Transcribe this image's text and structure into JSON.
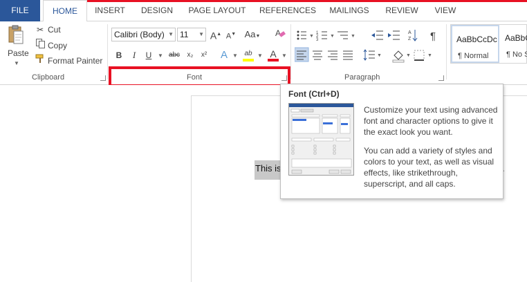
{
  "tabs": [
    "FILE",
    "HOME",
    "INSERT",
    "DESIGN",
    "PAGE LAYOUT",
    "REFERENCES",
    "MAILINGS",
    "REVIEW",
    "VIEW"
  ],
  "clipboard": {
    "paste": "Paste",
    "cut": "Cut",
    "copy": "Copy",
    "format_painter": "Format Painter",
    "group_label": "Clipboard"
  },
  "font": {
    "name": "Calibri (Body)",
    "size": "11",
    "group_label": "Font",
    "bold": "B",
    "italic": "I",
    "underline": "U",
    "strike": "abc",
    "sub": "x₂",
    "sup": "x²",
    "change_case": "Aa",
    "grow": "A",
    "shrink": "A",
    "font_color": "A",
    "text_effects": "A",
    "highlight": "ab"
  },
  "paragraph": {
    "group_label": "Paragraph"
  },
  "styles": [
    {
      "sample": "AaBbCcDc",
      "name": "¶ Normal"
    },
    {
      "sample": "AaBbCcDc",
      "name": "¶ No Spac"
    }
  ],
  "document": {
    "text": "This is",
    "trailing": "."
  },
  "tooltip": {
    "title": "Font (Ctrl+D)",
    "para1": "Customize your text using advanced font and character options to give it the exact look you want.",
    "para2": "You can add a variety of styles and colors to your text, as well as visual effects, like strikethrough, superscript, and all caps."
  },
  "colors": {
    "file_tab": "#2b579a",
    "highlight_box": "#e81123",
    "highlighter": "#ffff00",
    "font_color": "#e81123"
  }
}
